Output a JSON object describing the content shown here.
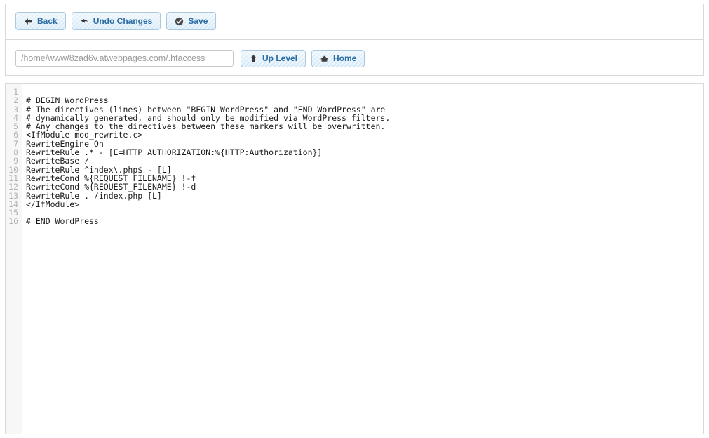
{
  "toolbar": {
    "buttons": [
      {
        "label": "Back",
        "icon": "arrow-left-icon"
      },
      {
        "label": "Undo Changes",
        "icon": "undo-icon"
      },
      {
        "label": "Save",
        "icon": "check-circle-icon"
      }
    ]
  },
  "path_bar": {
    "path_value": "/home/www/8zad6v.atwebpages.com/.htaccess",
    "path_placeholder": "/home/www/8zad6v.atwebpages.com/.htaccess",
    "buttons": [
      {
        "label": "Up Level",
        "icon": "arrow-up-icon"
      },
      {
        "label": "Home",
        "icon": "home-icon"
      }
    ]
  },
  "editor": {
    "line_numbers": [
      1,
      2,
      3,
      4,
      5,
      6,
      7,
      8,
      9,
      10,
      11,
      12,
      13,
      14,
      15,
      16
    ],
    "lines": [
      "",
      "# BEGIN WordPress",
      "# The directives (lines) between \"BEGIN WordPress\" and \"END WordPress\" are",
      "# dynamically generated, and should only be modified via WordPress filters.",
      "# Any changes to the directives between these markers will be overwritten.",
      "<IfModule mod_rewrite.c>",
      "RewriteEngine On",
      "RewriteRule .* - [E=HTTP_AUTHORIZATION:%{HTTP:Authorization}]",
      "RewriteBase /",
      "RewriteRule ^index\\.php$ - [L]",
      "RewriteCond %{REQUEST_FILENAME} !-f",
      "RewriteCond %{REQUEST_FILENAME} !-d",
      "RewriteRule . /index.php [L]",
      "</IfModule>",
      "",
      "# END WordPress"
    ]
  },
  "colors": {
    "button_text": "#2b6ca3",
    "button_border": "#aac9e0",
    "panel_border": "#d8d8d8",
    "gutter_text": "#b2b2b2",
    "code_text": "#1a1a1a",
    "path_text": "#9a9a9a"
  }
}
